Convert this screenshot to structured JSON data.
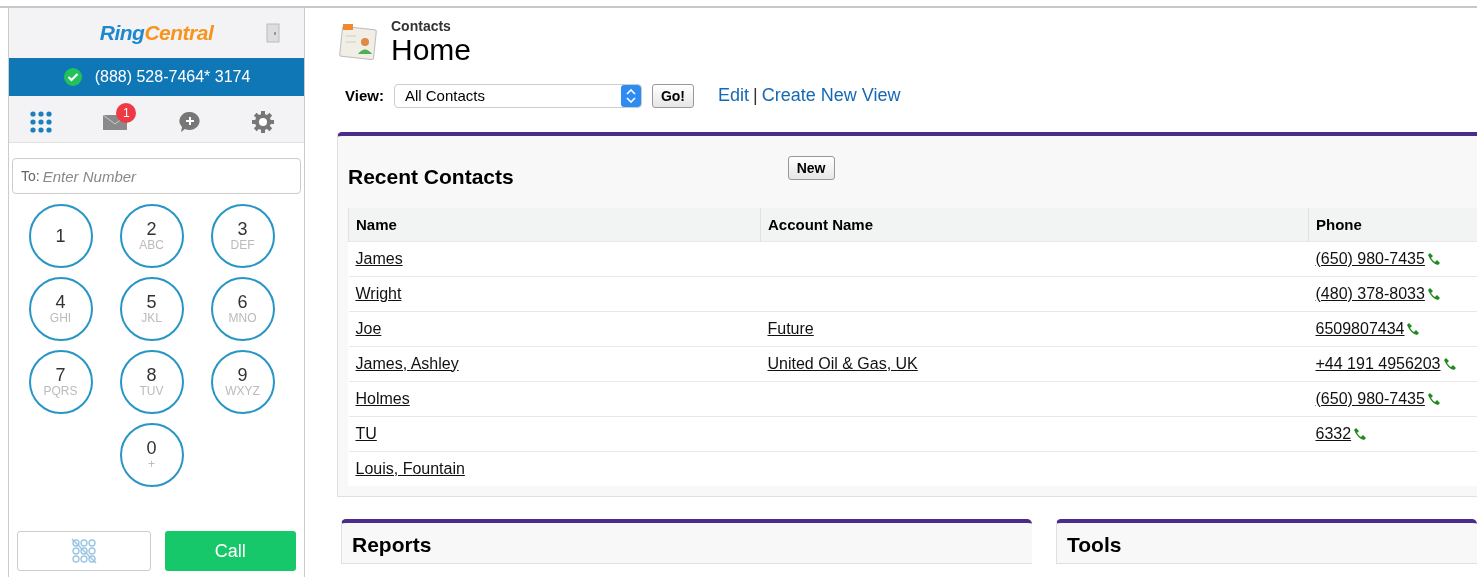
{
  "phone_panel": {
    "logo": {
      "first": "Ring",
      "second": "Central"
    },
    "status": {
      "online": true,
      "number": "(888) 528-7464* 3174"
    },
    "nav": [
      {
        "kind": "dialpad",
        "selected": true
      },
      {
        "kind": "messages",
        "selected": false,
        "badge": "1"
      },
      {
        "kind": "compose",
        "selected": false
      },
      {
        "kind": "settings",
        "selected": false
      }
    ],
    "to_field": {
      "label": "To:",
      "placeholder": "Enter Number"
    },
    "keys": [
      {
        "digit": "1"
      },
      {
        "digit": "2",
        "letters": "ABC"
      },
      {
        "digit": "3",
        "letters": "DEF"
      },
      {
        "digit": "4",
        "letters": "GHI"
      },
      {
        "digit": "5",
        "letters": "JKL"
      },
      {
        "digit": "6",
        "letters": "MNO"
      },
      {
        "digit": "7",
        "letters": "PQRS"
      },
      {
        "digit": "8",
        "letters": "TUV"
      },
      {
        "digit": "9",
        "letters": "WXYZ"
      },
      {
        "digit": "0",
        "letters": "+"
      }
    ],
    "call_button": "Call"
  },
  "header": {
    "section": "Contacts",
    "title": "Home"
  },
  "view": {
    "label": "View:",
    "value": "All Contacts",
    "go": "Go!",
    "links": [
      "Edit",
      "Create New View"
    ],
    "separator": "|"
  },
  "recent_contacts": {
    "title": "Recent Contacts",
    "new_button": "New",
    "columns": [
      "Name",
      "Account Name",
      "Phone"
    ],
    "rows": [
      {
        "name": "James",
        "account": "",
        "phone": "(650) 980-7435"
      },
      {
        "name": "Wright",
        "account": "",
        "phone": "(480) 378-8033"
      },
      {
        "name": "Joe",
        "account": "Future",
        "phone": "6509807434"
      },
      {
        "name": "James, Ashley",
        "account": "United Oil & Gas, UK",
        "phone": "+44 191 4956203"
      },
      {
        "name": "Holmes",
        "account": "",
        "phone": "(650) 980-7435"
      },
      {
        "name": "TU",
        "account": "",
        "phone": "6332"
      },
      {
        "name": "Louis, Fountain",
        "account": "",
        "phone": ""
      }
    ]
  },
  "panels": [
    "Reports",
    "Tools"
  ]
}
